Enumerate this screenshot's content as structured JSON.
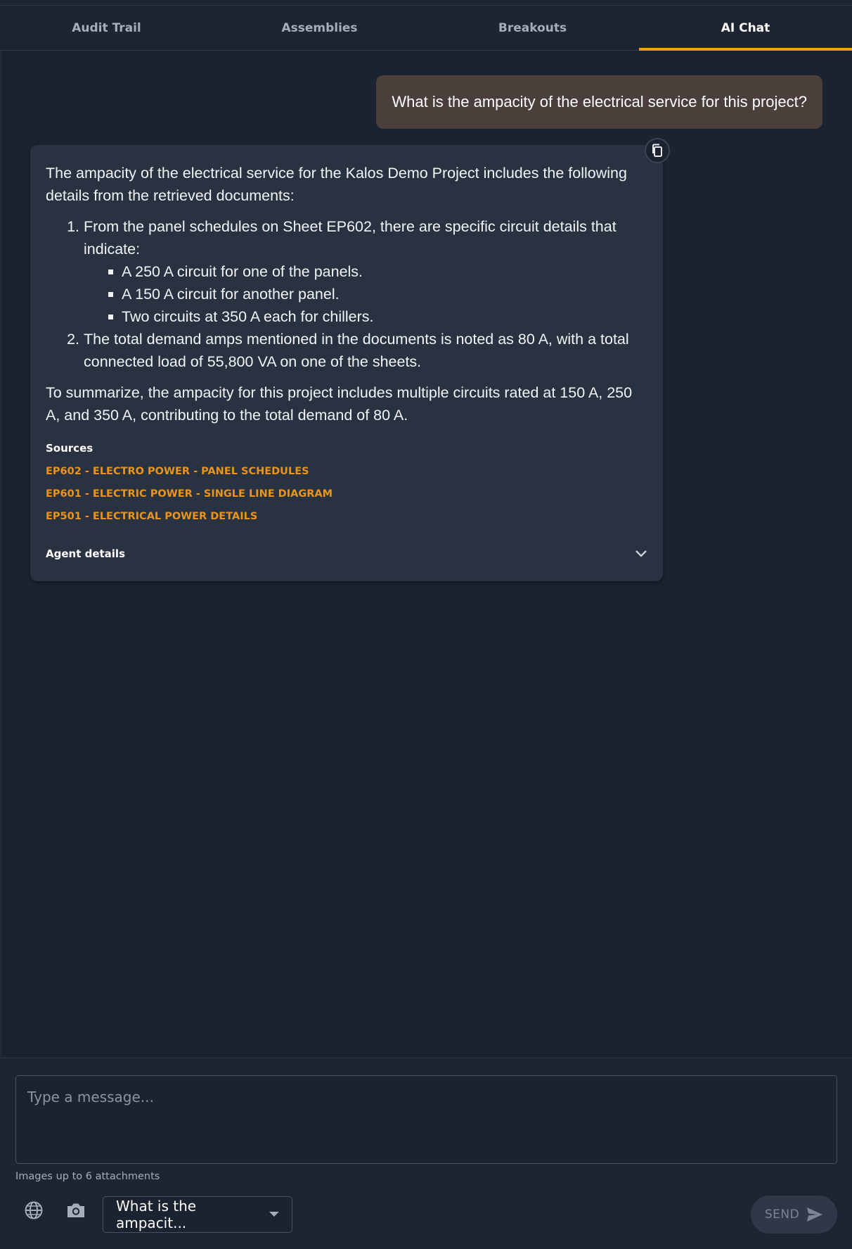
{
  "tabs": [
    {
      "label": "Audit Trail",
      "active": false
    },
    {
      "label": "Assemblies",
      "active": false
    },
    {
      "label": "Breakouts",
      "active": false
    },
    {
      "label": "AI Chat",
      "active": true
    }
  ],
  "conversation": {
    "user_message": "What is the ampacity of the electrical service for this project?",
    "ai_response": {
      "intro": "The ampacity of the electrical service for the Kalos Demo Project includes the following details from the retrieved documents:",
      "list": [
        {
          "text": "From the panel schedules on Sheet EP602, there are specific circuit details that indicate:",
          "subitems": [
            "A 250 A circuit for one of the panels.",
            "A 150 A circuit for another panel.",
            "Two circuits at 350 A each for chillers."
          ]
        },
        {
          "text": "The total demand amps mentioned in the documents is noted as 80 A, with a total connected load of 55,800 VA on one of the sheets."
        }
      ],
      "summary": "To summarize, the ampacity for this project includes multiple circuits rated at 150 A, 250 A, and 350 A, contributing to the total demand of 80 A.",
      "sources_title": "Sources",
      "sources": [
        "EP602 - ELECTRO POWER - PANEL SCHEDULES",
        "EP601 - ELECTRIC POWER - SINGLE LINE DIAGRAM",
        "EP501 - ELECTRICAL POWER DETAILS"
      ],
      "agent_details_label": "Agent details"
    }
  },
  "composer": {
    "placeholder": "Type a message...",
    "hint": "Images up to 6 attachments",
    "select_value": "What is the ampacit...",
    "send_label": "SEND",
    "icons": [
      "globe-icon",
      "camera-icon",
      "send-icon"
    ]
  },
  "colors": {
    "accent": "#f39c1f",
    "background": "#1b2230",
    "user_bubble": "#4a3f3a",
    "ai_card": "#293241",
    "source_link": "#e8951f"
  }
}
